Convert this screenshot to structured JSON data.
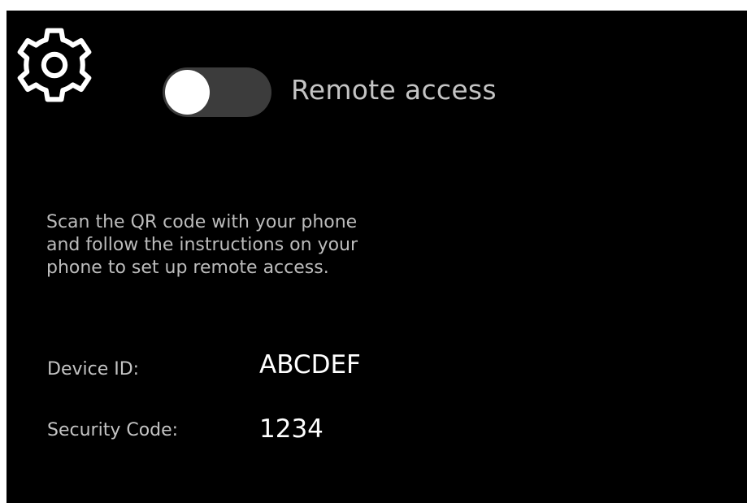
{
  "settings": {
    "icon": "gear-icon"
  },
  "remote_access": {
    "label": "Remote access",
    "enabled": false
  },
  "instructions": {
    "text": "Scan the QR code with your phone and follow the instructions on your phone to set up remote access."
  },
  "device": {
    "id_label": "Device ID:",
    "id_value": "ABCDEF",
    "security_label": "Security Code:",
    "security_value": "1234"
  },
  "colors": {
    "background": "#000000",
    "toggle_track": "#3c3c3c",
    "toggle_knob": "#ffffff",
    "muted_text": "#c4c4c4",
    "value_text": "#ffffff"
  }
}
